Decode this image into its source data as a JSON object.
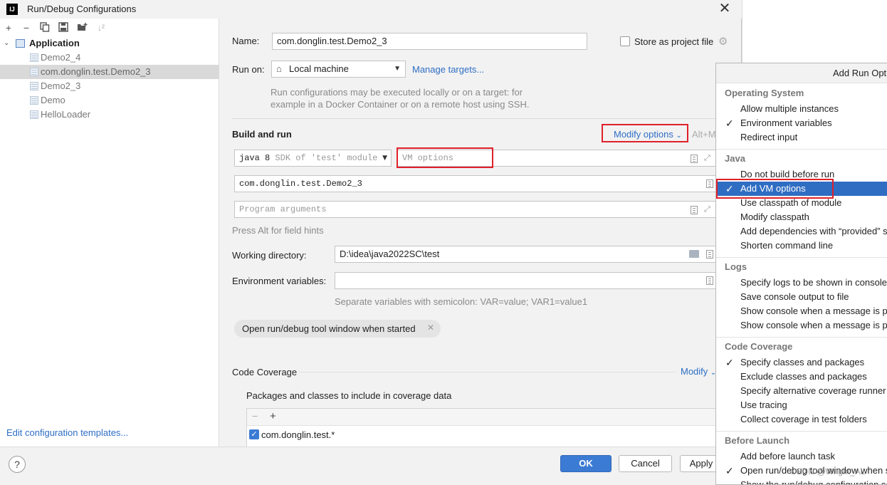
{
  "window": {
    "app_logo": "IJ",
    "title": "Run/Debug Configurations"
  },
  "toolbar": {
    "icons": [
      "add-icon",
      "remove-icon",
      "copy-icon",
      "save-icon",
      "new-folder-icon",
      "sort-icon"
    ]
  },
  "tree": {
    "root_label": "Application",
    "items": [
      {
        "label": "Demo2_4",
        "selected": false
      },
      {
        "label": "com.donglin.test.Demo2_3",
        "selected": true
      },
      {
        "label": "Demo2_3",
        "selected": false
      },
      {
        "label": "Demo",
        "selected": false
      },
      {
        "label": "HelloLoader",
        "selected": false
      }
    ]
  },
  "left_footer": {
    "edit_templates": "Edit configuration templates..."
  },
  "form": {
    "name_label": "Name:",
    "name_value": "com.donglin.test.Demo2_3",
    "store_label": "Store as project file",
    "run_on_label": "Run on:",
    "run_on_value": "Local machine",
    "manage_targets": "Manage targets...",
    "run_on_hint_1": "Run configurations may be executed locally or on a target: for",
    "run_on_hint_2": "example in a Docker Container or on a remote host using SSH.",
    "build_and_run": "Build and run",
    "modify_options": "Modify options",
    "modify_shortcut": "Alt+M",
    "sdk_value": "java 8",
    "sdk_hint": "SDK of 'test' module",
    "vm_placeholder": "VM options",
    "main_class": "com.donglin.test.Demo2_3",
    "program_args_placeholder": "Program arguments",
    "press_alt": "Press Alt for field hints",
    "working_dir_label": "Working directory:",
    "working_dir_value": "D:\\idea\\java2022SC\\test",
    "env_label": "Environment variables:",
    "env_value": "",
    "env_hint": "Separate variables with semicolon: VAR=value; VAR1=value1",
    "chip_label": "Open run/debug tool window when started",
    "code_coverage": "Code Coverage",
    "coverage_modify": "Modify",
    "packages_label": "Packages and classes to include in coverage data",
    "package_entry": "com.donglin.test.*"
  },
  "buttons": {
    "help": "?",
    "ok": "OK",
    "cancel": "Cancel",
    "apply": "Apply"
  },
  "popup": {
    "title": "Add Run Options",
    "groups": [
      {
        "name": "Operating System",
        "items": [
          {
            "label": "Allow multiple instances",
            "checked": false
          },
          {
            "label": "Environment variables",
            "checked": true
          },
          {
            "label": "Redirect input",
            "checked": false
          }
        ]
      },
      {
        "name": "Java",
        "items": [
          {
            "label": "Do not build before run",
            "checked": false
          },
          {
            "label": "Add VM options",
            "checked": true,
            "selected": true
          },
          {
            "label": "Use classpath of module",
            "checked": false
          },
          {
            "label": "Modify classpath",
            "checked": false
          },
          {
            "label": "Add dependencies with “provided” scope",
            "checked": false
          },
          {
            "label": "Shorten command line",
            "checked": false
          }
        ]
      },
      {
        "name": "Logs",
        "items": [
          {
            "label": "Specify logs to be shown in console",
            "checked": false
          },
          {
            "label": "Save console output to file",
            "checked": false
          },
          {
            "label": "Show console when a message is printed to stdout",
            "checked": false
          },
          {
            "label": "Show console when a message is printed to stderr",
            "checked": false
          }
        ]
      },
      {
        "name": "Code Coverage",
        "items": [
          {
            "label": "Specify classes and packages",
            "checked": true
          },
          {
            "label": "Exclude classes and packages",
            "checked": false
          },
          {
            "label": "Specify alternative coverage runner",
            "checked": false
          },
          {
            "label": "Use tracing",
            "checked": false
          },
          {
            "label": "Collect coverage in test folders",
            "checked": false
          }
        ]
      },
      {
        "name": "Before Launch",
        "items": [
          {
            "label": "Add before launch task",
            "checked": false
          },
          {
            "label": "Open run/debug tool window when started",
            "checked": true
          },
          {
            "label": "Show the run/debug configuration settings before start",
            "checked": false
          }
        ]
      }
    ]
  },
  "watermark": "CSDN @Wright_AL",
  "colors": {
    "accent": "#2e6ec4",
    "selection": "#2f6dc3",
    "highlight_box": "#e0202a",
    "ok_button": "#3b7bd4"
  }
}
